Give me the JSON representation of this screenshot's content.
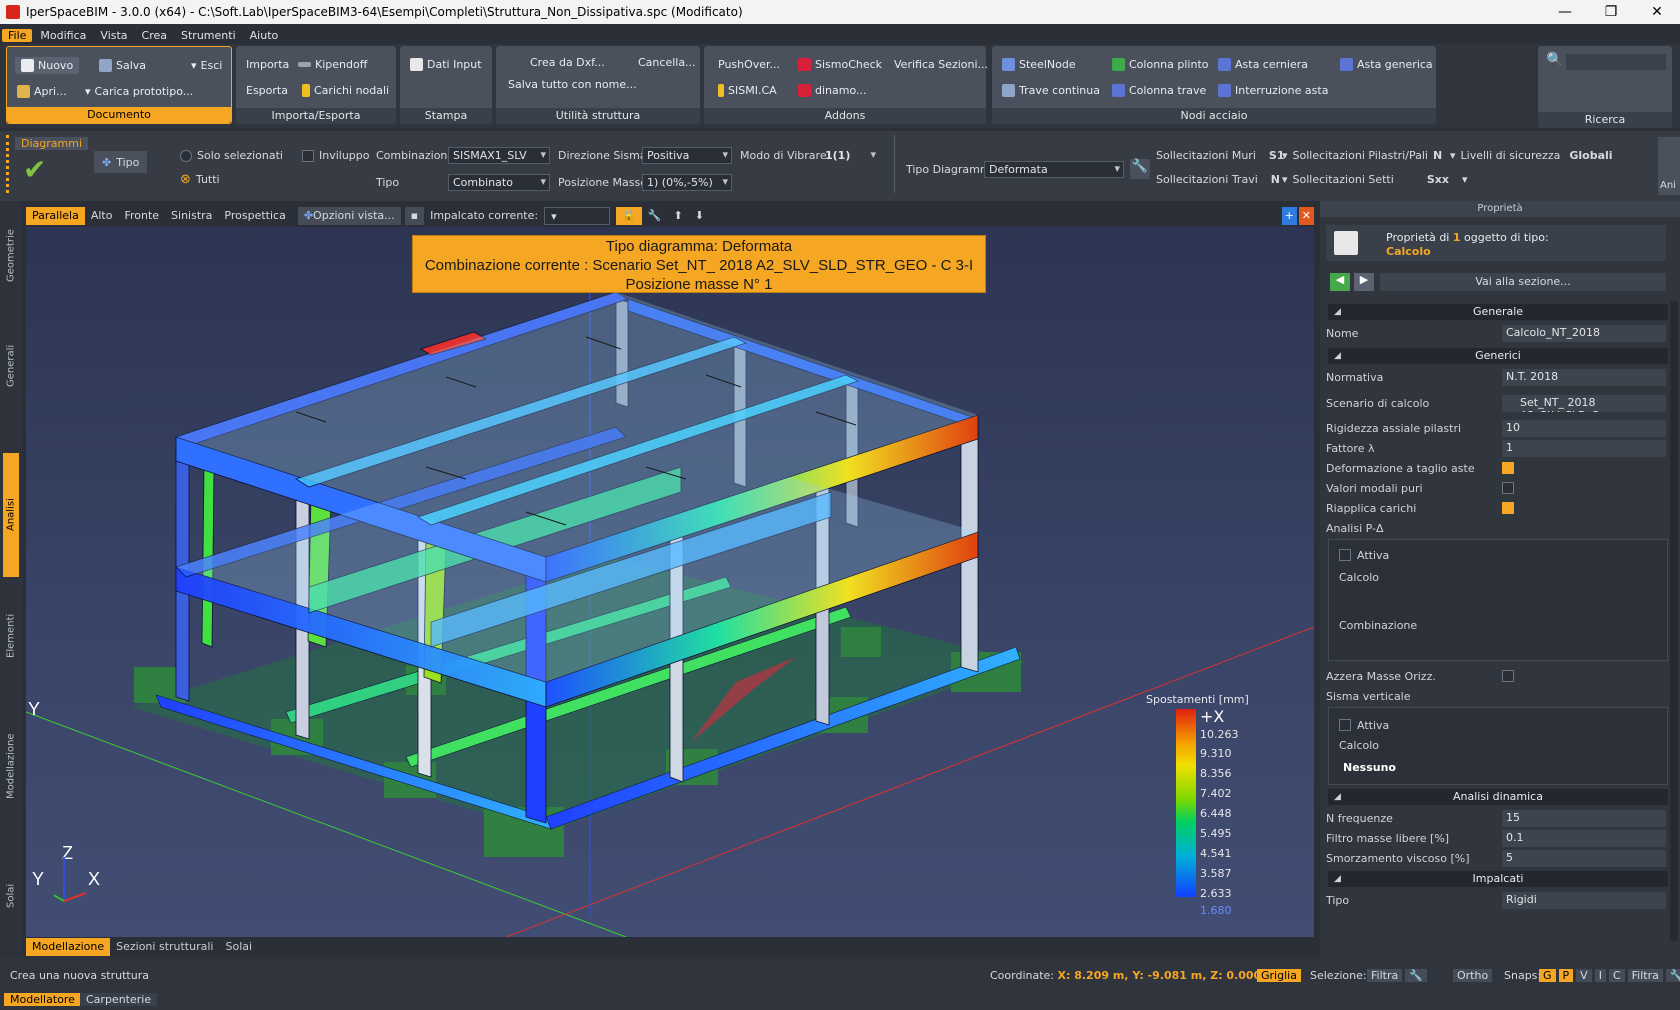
{
  "window": {
    "title": "IperSpaceBIM - 3.0.0 (x64) - C:\\Soft.Lab\\IperSpaceBIM3-64\\Esempi\\Completi\\Struttura_Non_Dissipativa.spc (Modificato)",
    "minimize": "—",
    "restore": "❐",
    "close": "✕"
  },
  "menu": [
    "File",
    "Modifica",
    "Vista",
    "Crea",
    "Strumenti",
    "Aiuto"
  ],
  "ribbon": {
    "documento": {
      "title": "Documento",
      "nuovo": "Nuovo",
      "salva": "Salva",
      "esci": "Esci",
      "apri": "Apri...",
      "carica": "Carica prototipo..."
    },
    "importa": {
      "title": "Importa/Esporta",
      "importa": "Importa",
      "kipendoff": "Kipendoff",
      "esporta": "Esporta",
      "carichi": "Carichi nodali"
    },
    "stampa": {
      "title": "Stampa",
      "dati": "Dati Input"
    },
    "utilita": {
      "title": "Utilità struttura",
      "dxf": "Crea da Dxf...",
      "cancella": "Cancella...",
      "salvatutto": "Salva tutto con nome..."
    },
    "addons": {
      "title": "Addons",
      "push": "PushOver...",
      "sismocheck": "SismoCheck",
      "verifica": "Verifica Sezioni...",
      "sismica": "SISMI.CA",
      "dinamo": "dinamo..."
    },
    "nodi": {
      "title": "Nodi acciaio",
      "steel": "SteelNode",
      "plinto": "Colonna plinto",
      "cerniera": "Asta cerniera",
      "generica": "Asta generica",
      "trave": "Trave continua",
      "coltrave": "Colonna trave",
      "interruzione": "Interruzione asta"
    },
    "ricerca": {
      "title": "Ricerca"
    }
  },
  "toolbar2": {
    "diagrammi": "Diagrammi",
    "tipo": "Tipo",
    "solo_selezionati": "Solo selezionati",
    "tutti": "Tutti",
    "inviluppo": "Inviluppo",
    "combinazione_label": "Combinazione",
    "combinazione_value": "SISMAX1_SLV",
    "tipo_label": "Tipo",
    "tipo_value": "Combinato",
    "direzione_label": "Direzione Sisma",
    "direzione_value": "Positiva",
    "posizione_label": "Posizione Masse",
    "posizione_value": "1) (0%,-5%)",
    "modo_label": "Modo di Vibrare",
    "modo_value": "1(1)",
    "tipo_diag_label": "Tipo Diagramma",
    "tipo_diag_value": "Deformata",
    "soll_muri": "Sollecitazioni Muri",
    "soll_muri_val": "S1",
    "soll_pilastri": "Sollecitazioni Pilastri/Pali",
    "soll_pilastri_val": "N",
    "livelli": "Livelli di sicurezza",
    "livelli_val": "Globali",
    "soll_travi": "Sollecitazioni Travi",
    "soll_travi_val": "N",
    "soll_setti": "Sollecitazioni Setti",
    "soll_setti_val": "Sxx",
    "ani": "Ani"
  },
  "left_tabs": [
    "Geometrie",
    "Generali",
    "Analisi",
    "Elementi",
    "Modellazione",
    "Solai"
  ],
  "viewbar": {
    "views": [
      "Parallela",
      "Alto",
      "Fronte",
      "Sinistra",
      "Prospettica"
    ],
    "opzioni": "Opzioni vista...",
    "impalcato": "Impalcato corrente:"
  },
  "viewport": {
    "banner_line1": "Tipo diagramma: Deformata",
    "banner_line2": "Combinazione corrente : Scenario Set_NT_ 2018 A2_SLV_SLD_STR_GEO - C 3-I",
    "banner_line3": "Posizione masse N° 1",
    "legend_title": "Spostamenti [mm]",
    "legend_values": [
      "+X",
      "10.263",
      "9.310",
      "8.356",
      "7.402",
      "6.448",
      "5.495",
      "4.541",
      "3.587",
      "2.633",
      "1.680"
    ],
    "axis_y": "Y",
    "axis_z": "Z",
    "axis_y2": "Y",
    "axis_x": "X"
  },
  "bottom_tabs": [
    "Modellazione",
    "Sezioni strutturali",
    "Solai"
  ],
  "properties": {
    "header": "Proprietà",
    "summary_prefix": "Proprietà di",
    "summary_count": "1",
    "summary_suffix": "oggetto di tipo:",
    "object_type": "Calcolo",
    "goto_section": "Vai alla sezione...",
    "sec_generale": "Generale",
    "nome_label": "Nome",
    "nome_value": "Calcolo_NT_2018",
    "sec_generici": "Generici",
    "normativa_label": "Normativa",
    "normativa_value": "N.T. 2018",
    "scenario_label": "Scenario di calcolo",
    "scenario_value": "Set_NT_ 2018 A2_SLV_SLD_S",
    "rigidezza_label": "Rigidezza assiale pilastri",
    "rigidezza_value": "10",
    "fattore_label": "Fattore λ",
    "fattore_value": "1",
    "deformazione_label": "Deformazione a taglio aste",
    "valori_label": "Valori modali puri",
    "riapplica_label": "Riapplica carichi",
    "analisi_pd_label": "Analisi P-Δ",
    "attiva1": "Attiva",
    "calcolo1": "Calcolo",
    "combinazione1": "Combinazione",
    "azzera_label": "Azzera Masse Orizz.",
    "sisma_label": "Sisma verticale",
    "attiva2": "Attiva",
    "calcolo2": "Calcolo",
    "nessuno": "Nessuno",
    "sec_dinamica": "Analisi dinamica",
    "nfreq_label": "N frequenze",
    "nfreq_value": "15",
    "filtro_label": "Filtro masse libere [%]",
    "filtro_value": "0.1",
    "smorz_label": "Smorzamento viscoso [%]",
    "smorz_value": "5",
    "sec_impalcati": "Impalcati",
    "tipo_label": "Tipo",
    "tipo_value": "Rigidi"
  },
  "status": {
    "message": "Crea una nuova struttura",
    "coord_label": "Coordinate:",
    "coord_value": "X: 8.209 m, Y: -9.081 m, Z: 0.000 m",
    "griglia": "Griglia",
    "selezione": "Selezione:",
    "filtra": "Filtra",
    "ortho": "Ortho",
    "snaps": "Snaps:",
    "snap_g": "G",
    "snap_p": "P",
    "snap_v": "V",
    "snap_i": "I",
    "snap_c": "C",
    "filtra2": "Filtra",
    "tab_modellatore": "Modellatore",
    "tab_carpenterie": "Carpenterie"
  },
  "colors": {
    "accent": "#f5a623",
    "panel": "#30353e",
    "viewport": "#3a4568"
  }
}
